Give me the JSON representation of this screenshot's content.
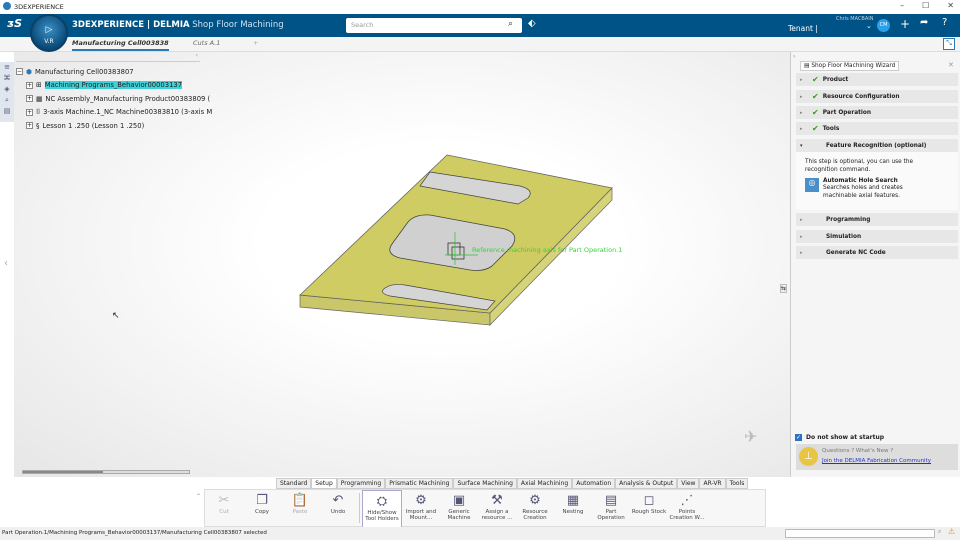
{
  "window": {
    "title": "3DEXPERIENCE",
    "minimize": "–",
    "maximize": "☐",
    "close": "✕"
  },
  "header": {
    "brand_bold": "3D",
    "brand_rest": "EXPERIENCE | DELMIA",
    "app": "Shop Floor Machining",
    "compass_version": "V.R",
    "search_placeholder": "Search",
    "user": "Chris MACBAIN",
    "tenant": "Tenant |",
    "avatar": "CM"
  },
  "tabs": [
    {
      "label": "Manufacturing Cell003838"
    },
    {
      "label": "Cuts A.1"
    },
    {
      "label": "+"
    }
  ],
  "tree": {
    "root": "Manufacturing Cell00383807",
    "children": [
      "Machining Programs_Behavior00003137",
      "NC Assembly_Manufacturing Product00383809 (",
      "3-axis Machine.1_NC Machine00383810 (3-axis M",
      "Lesson 1 .250 (Lesson 1 .250)"
    ]
  },
  "viewer": {
    "axis_label": "Reference machining axis for Part Operation.1",
    "colors": {
      "part": "#d9d84a",
      "header": "#005386"
    }
  },
  "wizard": {
    "title": "Shop Floor Machining Wizard",
    "steps": [
      {
        "label": "Product",
        "done": true
      },
      {
        "label": "Resource Configuration",
        "done": true
      },
      {
        "label": "Part Operation",
        "done": true
      },
      {
        "label": "Tools",
        "done": true
      },
      {
        "label": "Feature Recognition (optional)",
        "expanded": true
      },
      {
        "label": "Programming"
      },
      {
        "label": "Simulation"
      },
      {
        "label": "Generate NC Code"
      }
    ],
    "feature_text": "This step is optional, you can use the recognition command.",
    "command_title": "Automatic Hole Search",
    "command_desc": "Searches holes and creates machinable axial features.",
    "dont_show": "Do not show at startup",
    "questions": "Questions ? What's New ?",
    "community_link": "Join the DELMIA Fabrication Community"
  },
  "ribbon": {
    "tabs": [
      "Standard",
      "Setup",
      "Programming",
      "Prismatic Machining",
      "Surface Machining",
      "Axial Machining",
      "Automation",
      "Analysis & Output",
      "View",
      "AR-VR",
      "Tools"
    ],
    "active_tab": "Setup",
    "buttons": [
      {
        "label": "Cut",
        "icon": "✂",
        "disabled": true
      },
      {
        "label": "Copy",
        "icon": "❐"
      },
      {
        "label": "Paste",
        "icon": "📋",
        "disabled": true
      },
      {
        "label": "Undo",
        "icon": "↶"
      },
      {
        "label": "Hide/Show Tool Holders",
        "icon": "⛭"
      },
      {
        "label": "Import and Mount...",
        "icon": "⚙"
      },
      {
        "label": "Generic Machine",
        "icon": "▣"
      },
      {
        "label": "Assign a resource ...",
        "icon": "⚒"
      },
      {
        "label": "Resource Creation",
        "icon": "⚙"
      },
      {
        "label": "Nesting",
        "icon": "▦"
      },
      {
        "label": "Part Operation",
        "icon": "▤"
      },
      {
        "label": "Rough Stock",
        "icon": "◻"
      },
      {
        "label": "Points Creation W...",
        "icon": "⋰"
      }
    ]
  },
  "status": {
    "text": "Part Operation.1/Machining Programs_Behavior00003137/Manufacturing Cell00383807 selected"
  }
}
